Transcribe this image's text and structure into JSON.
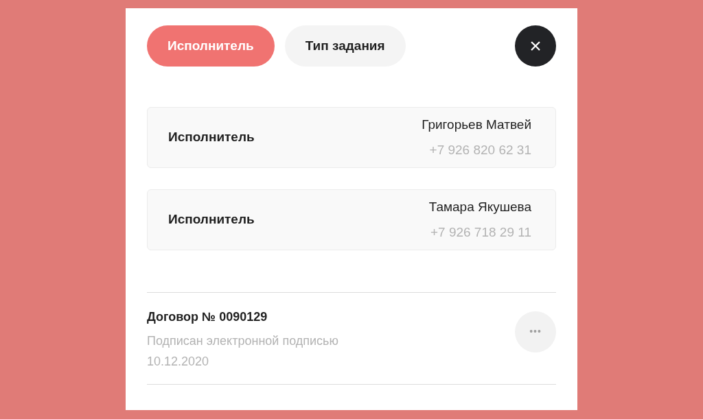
{
  "tabs": [
    {
      "label": "Исполнитель",
      "selected": true
    },
    {
      "label": "Тип задания",
      "selected": false
    }
  ],
  "close_button": {
    "label": "×"
  },
  "executors": [
    {
      "label": "Исполнитель",
      "name": "Григорьев Матвей",
      "phone": "+7 926 820 62 31"
    },
    {
      "label": "Исполнитель",
      "name": "Тамара Якушева",
      "phone": "+7 926 718 29 11"
    }
  ],
  "contract": {
    "title": "Договор № 0090129",
    "status": "Подписан электронной подписью",
    "date": "10.12.2020",
    "menu_label": "•••"
  }
}
